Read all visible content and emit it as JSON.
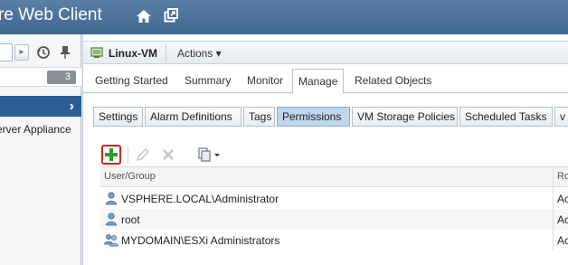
{
  "banner": {
    "title": "re Web Client",
    "home_icon": "home-icon",
    "popout_icon": "popout-icon"
  },
  "left_panel": {
    "back_icon": "chevron-right-icon",
    "history_icon": "history-icon",
    "pin_icon": "pin-icon",
    "count_badge": "3",
    "selected_chevron": "›",
    "tree_item": "erver Appliance"
  },
  "object_bar": {
    "vm_name": "Linux-VM",
    "actions_label": "Actions ▾"
  },
  "tabs": [
    {
      "label": "Getting Started",
      "active": false
    },
    {
      "label": "Summary",
      "active": false
    },
    {
      "label": "Monitor",
      "active": false
    },
    {
      "label": "Manage",
      "active": true
    },
    {
      "label": "Related Objects",
      "active": false
    }
  ],
  "subtabs": [
    {
      "label": "Settings",
      "active": false
    },
    {
      "label": "Alarm Definitions",
      "active": false
    },
    {
      "label": "Tags",
      "active": false
    },
    {
      "label": "Permissions",
      "active": true
    },
    {
      "label": "VM Storage Policies",
      "active": false
    },
    {
      "label": "Scheduled Tasks",
      "active": false
    },
    {
      "label": "v",
      "active": false
    }
  ],
  "toolbar": {
    "add_icon": "add-icon",
    "edit_icon": "edit-icon",
    "delete_icon": "delete-icon",
    "copy_icon": "copy-icon"
  },
  "grid": {
    "columns": [
      "User/Group",
      "Ro"
    ],
    "rows": [
      {
        "name": "VSPHERE.LOCAL\\Administrator",
        "role": "Ac",
        "icon": "user-icon"
      },
      {
        "name": "root",
        "role": "Ac",
        "icon": "user-icon"
      },
      {
        "name": "MYDOMAIN\\ESXi Administrators",
        "role": "Ac",
        "icon": "group-icon"
      }
    ]
  },
  "colors": {
    "banner": "#4a729b",
    "selected_row": "#2c5d95",
    "active_subtab": "#bfd6ef",
    "add_border": "#c62828",
    "add_plus": "#2e9a2e"
  }
}
